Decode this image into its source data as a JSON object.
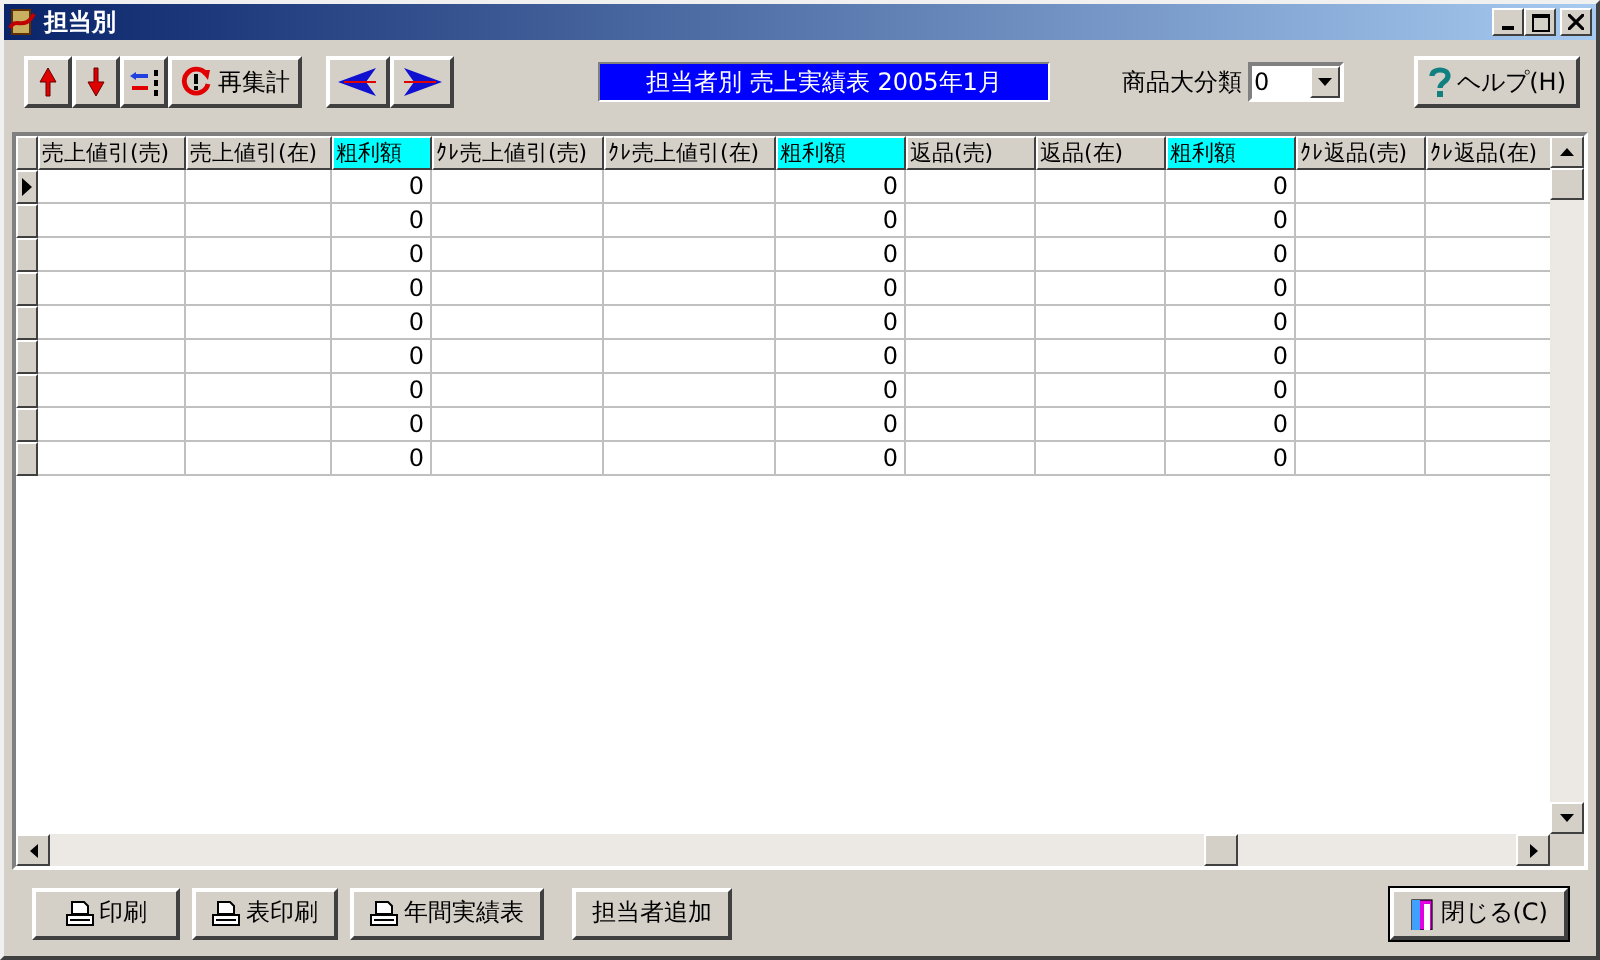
{
  "window": {
    "title": "担当別"
  },
  "toolbar": {
    "recalc_label": "再集計",
    "report_title": "担当者別  売上実績表 2005年1月",
    "category_label": "商品大分類",
    "category_value": "0",
    "help_label": "ヘルプ(H)"
  },
  "grid": {
    "columns": [
      {
        "label": "売上値引(売)",
        "highlight": false
      },
      {
        "label": "売上値引(在)",
        "highlight": false
      },
      {
        "label": "粗利額",
        "highlight": true
      },
      {
        "label": "ｸﾚ売上値引(売)",
        "highlight": false
      },
      {
        "label": "ｸﾚ売上値引(在)",
        "highlight": false
      },
      {
        "label": "粗利額",
        "highlight": true
      },
      {
        "label": "返品(売)",
        "highlight": false
      },
      {
        "label": "返品(在)",
        "highlight": false
      },
      {
        "label": "粗利額",
        "highlight": true
      },
      {
        "label": "ｸﾚ返品(売)",
        "highlight": false
      },
      {
        "label": "ｸﾚ返品(在)",
        "highlight": false
      }
    ],
    "rows": [
      {
        "selected": true,
        "cells": {
          "2": "0",
          "5": "0",
          "8": "0"
        }
      },
      {
        "selected": false,
        "cells": {
          "2": "0",
          "5": "0",
          "8": "0"
        }
      },
      {
        "selected": false,
        "cells": {
          "2": "0",
          "5": "0",
          "8": "0"
        }
      },
      {
        "selected": false,
        "cells": {
          "2": "0",
          "5": "0",
          "8": "0"
        }
      },
      {
        "selected": false,
        "cells": {
          "2": "0",
          "5": "0",
          "8": "0"
        }
      },
      {
        "selected": false,
        "cells": {
          "2": "0",
          "5": "0",
          "8": "0"
        }
      },
      {
        "selected": false,
        "cells": {
          "2": "0",
          "5": "0",
          "8": "0"
        }
      },
      {
        "selected": false,
        "cells": {
          "2": "0",
          "5": "0",
          "8": "0"
        }
      },
      {
        "selected": false,
        "cells": {
          "2": "0",
          "5": "0",
          "8": "0"
        }
      }
    ]
  },
  "buttons": [
    {
      "label": "印刷",
      "kind": "print"
    },
    {
      "label": "表印刷",
      "kind": "print"
    },
    {
      "label": "年間実績表",
      "kind": "print"
    },
    {
      "label": "担当者追加",
      "kind": "plain"
    },
    {
      "label": "閉じる(C)",
      "kind": "close"
    }
  ]
}
